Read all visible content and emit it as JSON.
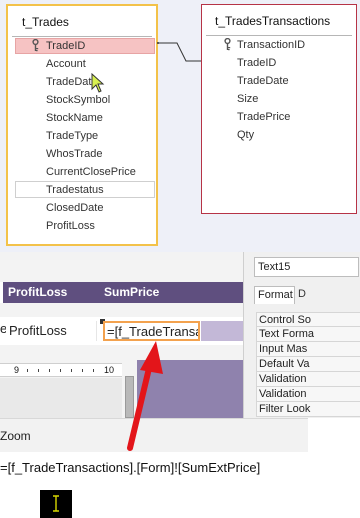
{
  "trades_table": {
    "title": "t_Trades",
    "fields": [
      "TradeID",
      "Account",
      "TradeDate",
      "StockSymbol",
      "StockName",
      "TradeType",
      "WhosTrade",
      "CurrentClosePrice",
      "Tradestatus",
      "ClosedDate",
      "ProfitLoss"
    ]
  },
  "transactions_table": {
    "title": "t_TradesTransactions",
    "fields": [
      "TransactionID",
      "TradeID",
      "TradeDate",
      "Size",
      "TradePrice",
      "Qty"
    ]
  },
  "form": {
    "header_labels": [
      "ProfitLoss",
      "SumPrice"
    ],
    "controls": {
      "left_fragment": "e",
      "profitloss": "ProfitLoss",
      "sumprice": "=[f_TradeTransactions].[Form]![SumExtPrice]"
    },
    "ruler_numbers": [
      "9",
      "10"
    ]
  },
  "property_sheet": {
    "selected_control": "Text15",
    "tabs": [
      "Format",
      "D"
    ],
    "rows": [
      "Control So",
      "Text Forma",
      "Input Mas",
      "Default Va",
      "Validation",
      "Validation",
      "Filter Look"
    ]
  },
  "zoom": {
    "label": "Zoom"
  },
  "expression": "=[f_TradeTransactions].[Form]![SumExtPrice]",
  "colors": {
    "selection_border": "#f3c24a",
    "primary_key_row": "#f6c3c3",
    "table_border": "#b63346",
    "header_band": "#5f4f7f",
    "annotation_arrow": "#e3151a"
  },
  "icons": [
    "primary-key-icon",
    "mouse-pointer-icon",
    "text-cursor-icon",
    "red-arrow-annotation"
  ]
}
